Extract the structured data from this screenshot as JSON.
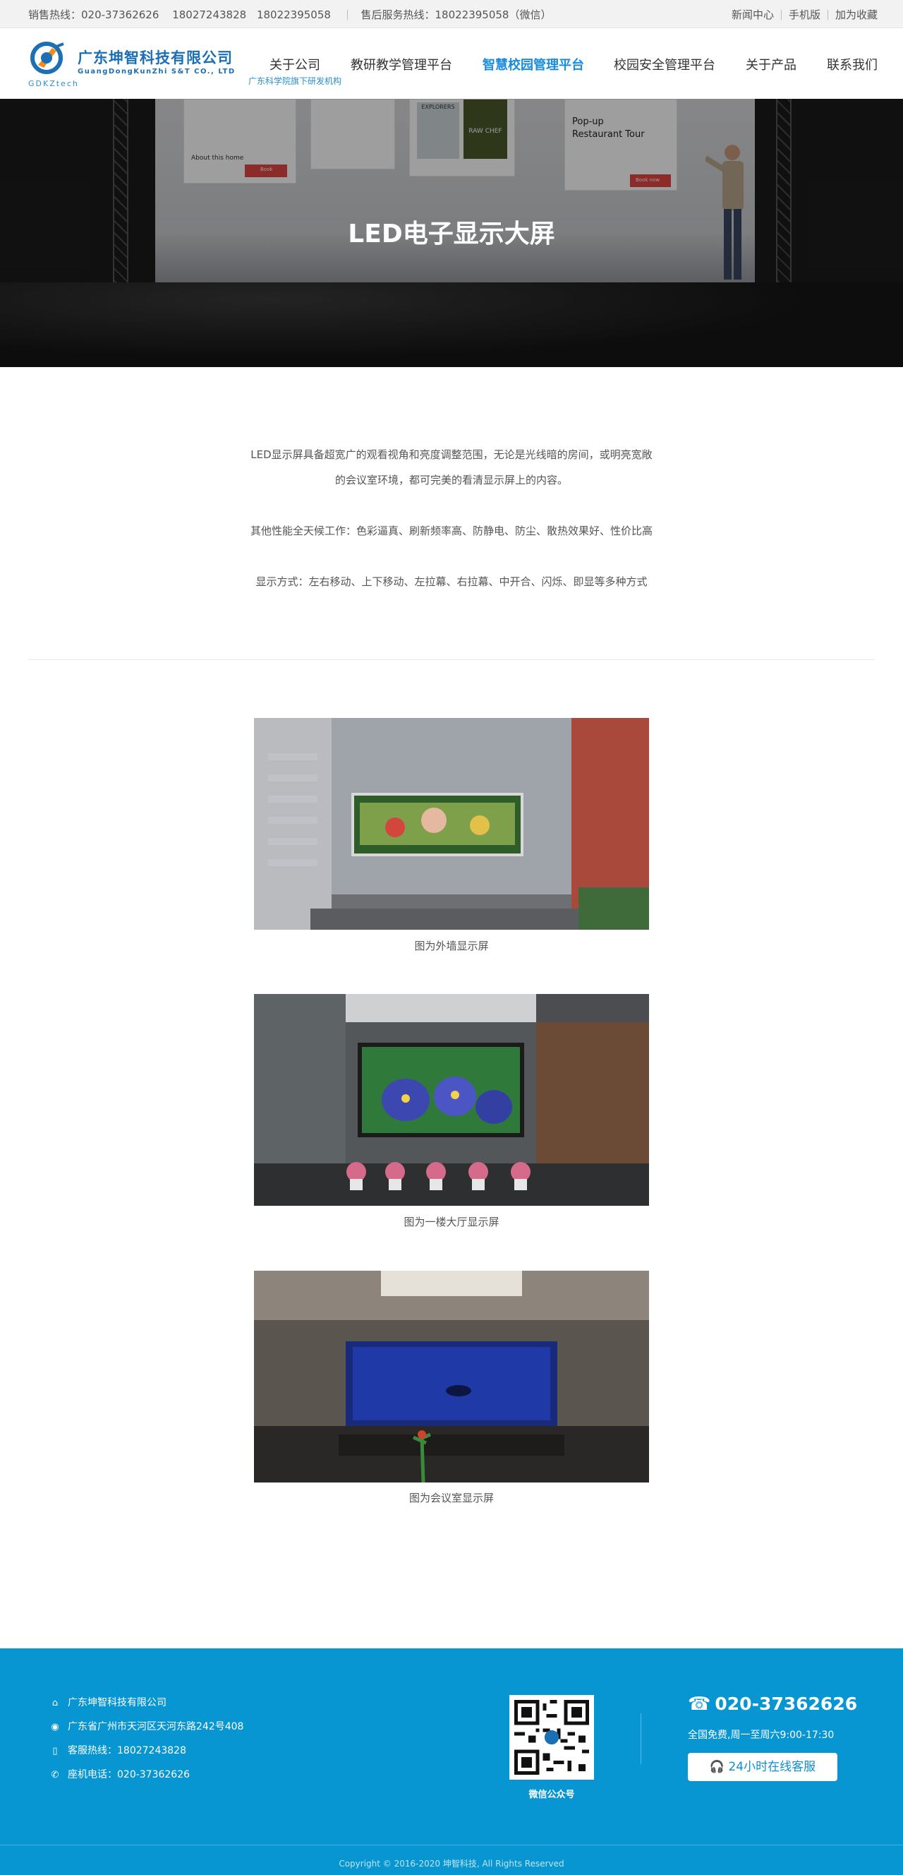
{
  "topbar": {
    "sales_hotline": "销售热线：020-37362626",
    "sales_mobile_1": "18027243828",
    "sales_mobile_2": "18022395058",
    "service_hotline": "售后服务热线：18022395058（微信）",
    "links": [
      "新闻中心",
      "手机版",
      "加为收藏"
    ]
  },
  "header": {
    "logo_cn": "广东坤智科技有限公司",
    "logo_en": "GuangDongKunZhi S&T CO., LTD",
    "logo_abbr": "GDKZtech",
    "tagline": "广东科学院旗下研发机构",
    "nav": [
      {
        "label": "关于公司",
        "active": false
      },
      {
        "label": "教研教学管理平台",
        "active": false
      },
      {
        "label": "智慧校园管理平台",
        "active": true
      },
      {
        "label": "校园安全管理平台",
        "active": false
      },
      {
        "label": "关于产品",
        "active": false
      },
      {
        "label": "联系我们",
        "active": false
      }
    ]
  },
  "banner": {
    "title": "LED电子显示大屏",
    "screen_texts": {
      "about_home": "About this home",
      "explorers": "EXPLORERS",
      "raw_chef": "RAW CHEF",
      "popup_1": "Pop-up",
      "popup_2": "Restaurant Tour",
      "book": "Book",
      "book_now": "Book now"
    }
  },
  "intro": {
    "p1_line1": "LED显示屏具备超宽广的观看视角和亮度调整范围，无论是光线暗的房间，或明亮宽敞",
    "p1_line2": "的会议室环境，都可完美的看清显示屏上的内容。",
    "p2": "其他性能全天候工作：色彩逼真、刷新频率高、防静电、防尘、散热效果好、性价比高",
    "p3": "显示方式：左右移动、上下移动、左拉幕、右拉幕、中开合、闪烁、即显等多种方式"
  },
  "photos": [
    {
      "caption": "图为外墙显示屏",
      "icon": "outdoor-wall-led-photo"
    },
    {
      "caption": "图为一楼大厅显示屏",
      "icon": "lobby-led-photo"
    },
    {
      "caption": "图为会议室显示屏",
      "icon": "meeting-room-led-photo"
    }
  ],
  "footer": {
    "company": "广东坤智科技有限公司",
    "address": "广东省广州市天河区天河东路242号408",
    "service_hotline": "客服热线：18027243828",
    "landline": "座机电话：020-37362626",
    "qr_caption": "微信公众号",
    "big_phone": "020-37362626",
    "hours": "全国免费,周一至周六9:00-17:30",
    "service_button": "24小时在线客服",
    "copyright": "Copyright © 2016-2020 坤智科技, All Rights Reserved"
  },
  "colors": {
    "brand_blue": "#1a6fb5",
    "nav_active": "#1a8ce0",
    "footer_bg": "#0796d2",
    "topbar_bg": "#f2f2f2"
  }
}
